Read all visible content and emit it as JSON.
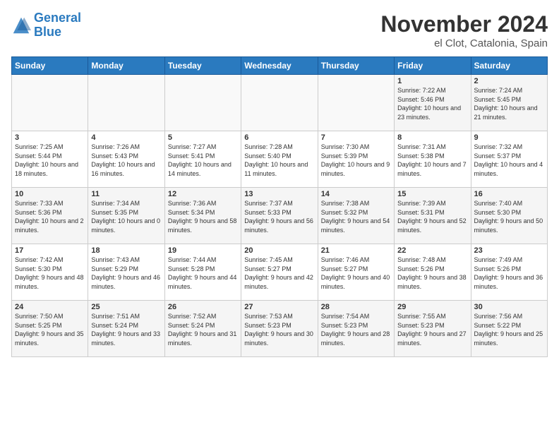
{
  "header": {
    "logo_line1": "General",
    "logo_line2": "Blue",
    "month_title": "November 2024",
    "location": "el Clot, Catalonia, Spain"
  },
  "weekdays": [
    "Sunday",
    "Monday",
    "Tuesday",
    "Wednesday",
    "Thursday",
    "Friday",
    "Saturday"
  ],
  "weeks": [
    [
      {
        "day": "",
        "sunrise": "",
        "sunset": "",
        "daylight": ""
      },
      {
        "day": "",
        "sunrise": "",
        "sunset": "",
        "daylight": ""
      },
      {
        "day": "",
        "sunrise": "",
        "sunset": "",
        "daylight": ""
      },
      {
        "day": "",
        "sunrise": "",
        "sunset": "",
        "daylight": ""
      },
      {
        "day": "",
        "sunrise": "",
        "sunset": "",
        "daylight": ""
      },
      {
        "day": "1",
        "sunrise": "Sunrise: 7:22 AM",
        "sunset": "Sunset: 5:46 PM",
        "daylight": "Daylight: 10 hours and 23 minutes."
      },
      {
        "day": "2",
        "sunrise": "Sunrise: 7:24 AM",
        "sunset": "Sunset: 5:45 PM",
        "daylight": "Daylight: 10 hours and 21 minutes."
      }
    ],
    [
      {
        "day": "3",
        "sunrise": "Sunrise: 7:25 AM",
        "sunset": "Sunset: 5:44 PM",
        "daylight": "Daylight: 10 hours and 18 minutes."
      },
      {
        "day": "4",
        "sunrise": "Sunrise: 7:26 AM",
        "sunset": "Sunset: 5:43 PM",
        "daylight": "Daylight: 10 hours and 16 minutes."
      },
      {
        "day": "5",
        "sunrise": "Sunrise: 7:27 AM",
        "sunset": "Sunset: 5:41 PM",
        "daylight": "Daylight: 10 hours and 14 minutes."
      },
      {
        "day": "6",
        "sunrise": "Sunrise: 7:28 AM",
        "sunset": "Sunset: 5:40 PM",
        "daylight": "Daylight: 10 hours and 11 minutes."
      },
      {
        "day": "7",
        "sunrise": "Sunrise: 7:30 AM",
        "sunset": "Sunset: 5:39 PM",
        "daylight": "Daylight: 10 hours and 9 minutes."
      },
      {
        "day": "8",
        "sunrise": "Sunrise: 7:31 AM",
        "sunset": "Sunset: 5:38 PM",
        "daylight": "Daylight: 10 hours and 7 minutes."
      },
      {
        "day": "9",
        "sunrise": "Sunrise: 7:32 AM",
        "sunset": "Sunset: 5:37 PM",
        "daylight": "Daylight: 10 hours and 4 minutes."
      }
    ],
    [
      {
        "day": "10",
        "sunrise": "Sunrise: 7:33 AM",
        "sunset": "Sunset: 5:36 PM",
        "daylight": "Daylight: 10 hours and 2 minutes."
      },
      {
        "day": "11",
        "sunrise": "Sunrise: 7:34 AM",
        "sunset": "Sunset: 5:35 PM",
        "daylight": "Daylight: 10 hours and 0 minutes."
      },
      {
        "day": "12",
        "sunrise": "Sunrise: 7:36 AM",
        "sunset": "Sunset: 5:34 PM",
        "daylight": "Daylight: 9 hours and 58 minutes."
      },
      {
        "day": "13",
        "sunrise": "Sunrise: 7:37 AM",
        "sunset": "Sunset: 5:33 PM",
        "daylight": "Daylight: 9 hours and 56 minutes."
      },
      {
        "day": "14",
        "sunrise": "Sunrise: 7:38 AM",
        "sunset": "Sunset: 5:32 PM",
        "daylight": "Daylight: 9 hours and 54 minutes."
      },
      {
        "day": "15",
        "sunrise": "Sunrise: 7:39 AM",
        "sunset": "Sunset: 5:31 PM",
        "daylight": "Daylight: 9 hours and 52 minutes."
      },
      {
        "day": "16",
        "sunrise": "Sunrise: 7:40 AM",
        "sunset": "Sunset: 5:30 PM",
        "daylight": "Daylight: 9 hours and 50 minutes."
      }
    ],
    [
      {
        "day": "17",
        "sunrise": "Sunrise: 7:42 AM",
        "sunset": "Sunset: 5:30 PM",
        "daylight": "Daylight: 9 hours and 48 minutes."
      },
      {
        "day": "18",
        "sunrise": "Sunrise: 7:43 AM",
        "sunset": "Sunset: 5:29 PM",
        "daylight": "Daylight: 9 hours and 46 minutes."
      },
      {
        "day": "19",
        "sunrise": "Sunrise: 7:44 AM",
        "sunset": "Sunset: 5:28 PM",
        "daylight": "Daylight: 9 hours and 44 minutes."
      },
      {
        "day": "20",
        "sunrise": "Sunrise: 7:45 AM",
        "sunset": "Sunset: 5:27 PM",
        "daylight": "Daylight: 9 hours and 42 minutes."
      },
      {
        "day": "21",
        "sunrise": "Sunrise: 7:46 AM",
        "sunset": "Sunset: 5:27 PM",
        "daylight": "Daylight: 9 hours and 40 minutes."
      },
      {
        "day": "22",
        "sunrise": "Sunrise: 7:48 AM",
        "sunset": "Sunset: 5:26 PM",
        "daylight": "Daylight: 9 hours and 38 minutes."
      },
      {
        "day": "23",
        "sunrise": "Sunrise: 7:49 AM",
        "sunset": "Sunset: 5:26 PM",
        "daylight": "Daylight: 9 hours and 36 minutes."
      }
    ],
    [
      {
        "day": "24",
        "sunrise": "Sunrise: 7:50 AM",
        "sunset": "Sunset: 5:25 PM",
        "daylight": "Daylight: 9 hours and 35 minutes."
      },
      {
        "day": "25",
        "sunrise": "Sunrise: 7:51 AM",
        "sunset": "Sunset: 5:24 PM",
        "daylight": "Daylight: 9 hours and 33 minutes."
      },
      {
        "day": "26",
        "sunrise": "Sunrise: 7:52 AM",
        "sunset": "Sunset: 5:24 PM",
        "daylight": "Daylight: 9 hours and 31 minutes."
      },
      {
        "day": "27",
        "sunrise": "Sunrise: 7:53 AM",
        "sunset": "Sunset: 5:23 PM",
        "daylight": "Daylight: 9 hours and 30 minutes."
      },
      {
        "day": "28",
        "sunrise": "Sunrise: 7:54 AM",
        "sunset": "Sunset: 5:23 PM",
        "daylight": "Daylight: 9 hours and 28 minutes."
      },
      {
        "day": "29",
        "sunrise": "Sunrise: 7:55 AM",
        "sunset": "Sunset: 5:23 PM",
        "daylight": "Daylight: 9 hours and 27 minutes."
      },
      {
        "day": "30",
        "sunrise": "Sunrise: 7:56 AM",
        "sunset": "Sunset: 5:22 PM",
        "daylight": "Daylight: 9 hours and 25 minutes."
      }
    ]
  ]
}
